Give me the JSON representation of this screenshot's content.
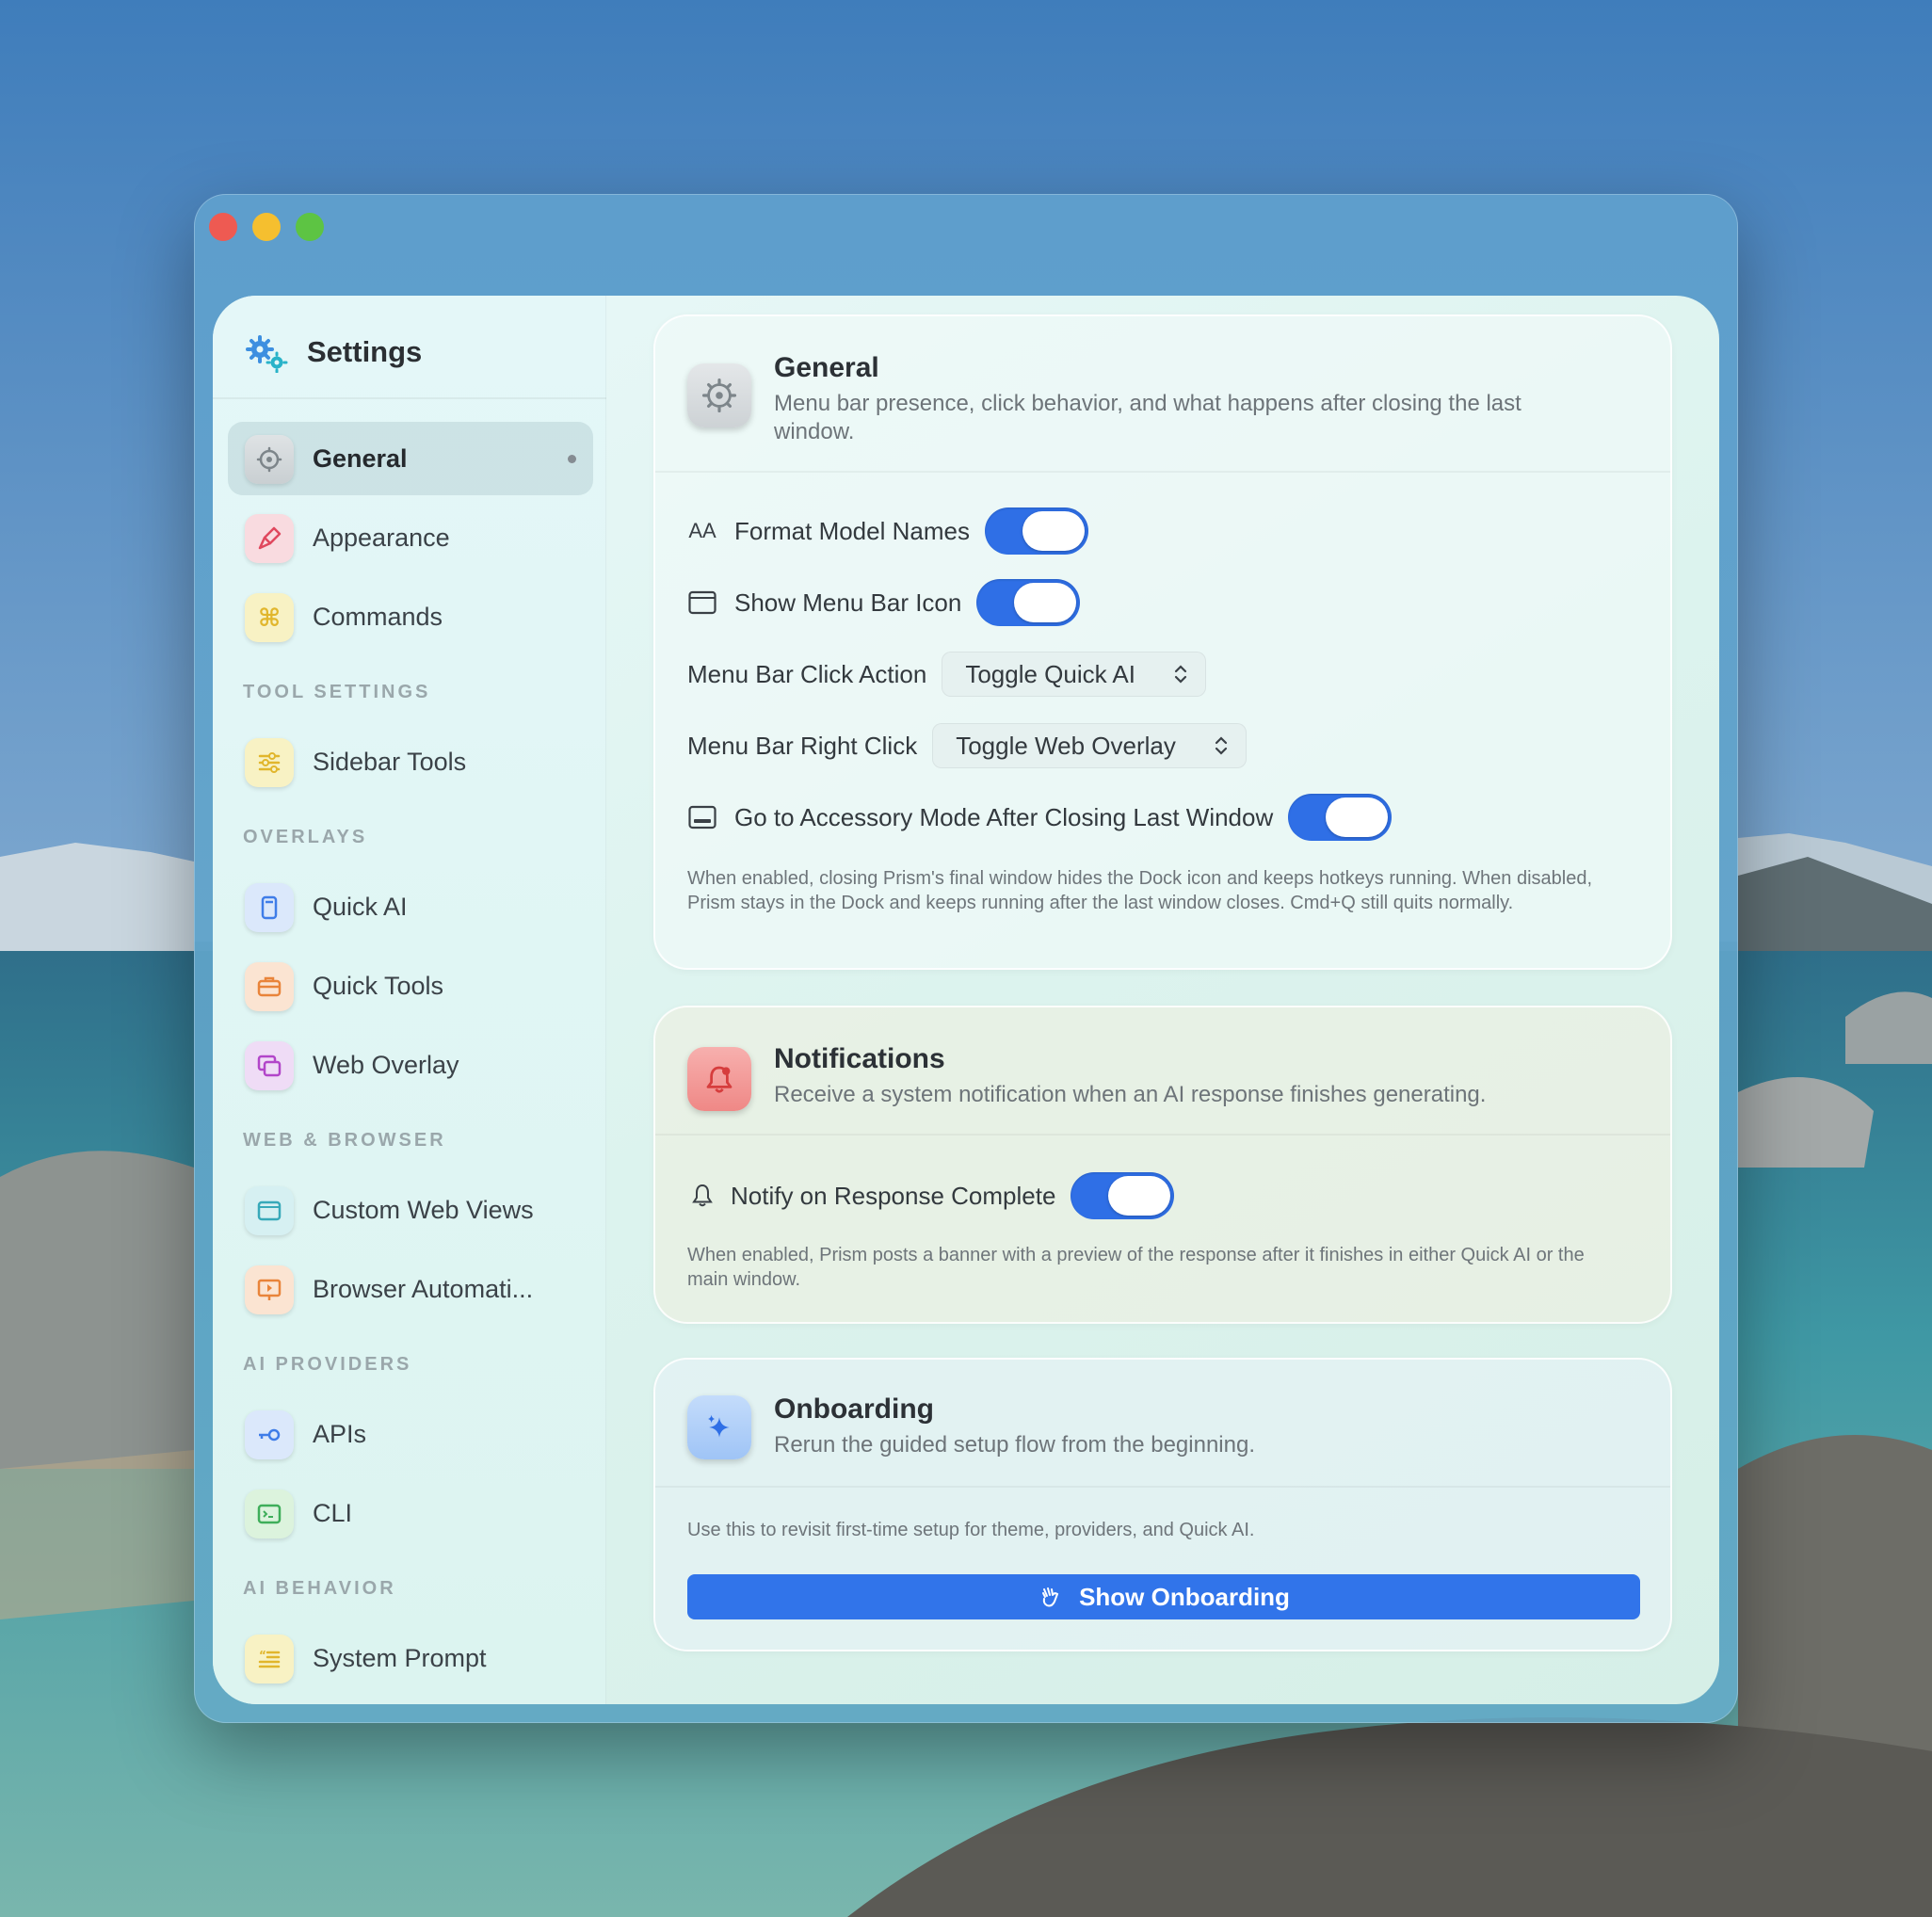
{
  "sidebar": {
    "title": "Settings",
    "items": [
      {
        "label": "General"
      },
      {
        "label": "Appearance"
      },
      {
        "label": "Commands"
      },
      {
        "label": "Sidebar Tools"
      },
      {
        "label": "Quick AI"
      },
      {
        "label": "Quick Tools"
      },
      {
        "label": "Web Overlay"
      },
      {
        "label": "Custom Web Views"
      },
      {
        "label": "Browser Automati..."
      },
      {
        "label": "APIs"
      },
      {
        "label": "CLI"
      },
      {
        "label": "System Prompt"
      }
    ],
    "sections": {
      "tool_settings": "TOOL SETTINGS",
      "overlays": "OVERLAYS",
      "web_browser": "WEB & BROWSER",
      "ai_providers": "AI PROVIDERS",
      "ai_behavior": "AI BEHAVIOR"
    }
  },
  "general": {
    "title": "General",
    "subtitle": "Menu bar presence, click behavior, and what happens after closing the last window.",
    "format_model_names": {
      "label": "Format Model Names",
      "icon_text": "AA",
      "enabled": true
    },
    "show_menu_bar_icon": {
      "label": "Show Menu Bar Icon",
      "enabled": true
    },
    "menu_bar_click_action": {
      "label": "Menu Bar Click Action",
      "value": "Toggle Quick AI"
    },
    "menu_bar_right_click": {
      "label": "Menu Bar Right Click",
      "value": "Toggle Web Overlay"
    },
    "accessory_mode": {
      "label": "Go to Accessory Mode After Closing Last Window",
      "enabled": true
    },
    "help": "When enabled, closing Prism's final window hides the Dock icon and keeps hotkeys running. When disabled, Prism stays in the Dock and keeps running after the last window closes. Cmd+Q still quits normally."
  },
  "notifications": {
    "title": "Notifications",
    "subtitle": "Receive a system notification when an AI response finishes generating.",
    "notify_on_complete": {
      "label": "Notify on Response Complete",
      "enabled": true
    },
    "help": "When enabled, Prism posts a banner with a preview of the response after it finishes in either Quick AI or the main window."
  },
  "onboarding": {
    "title": "Onboarding",
    "subtitle": "Rerun the guided setup flow from the beginning.",
    "help": "Use this to revisit first-time setup for theme, providers, and Quick AI.",
    "button_label": "Show Onboarding"
  },
  "colors": {
    "accent": "#2f6fe6",
    "button": "#3174ea"
  }
}
